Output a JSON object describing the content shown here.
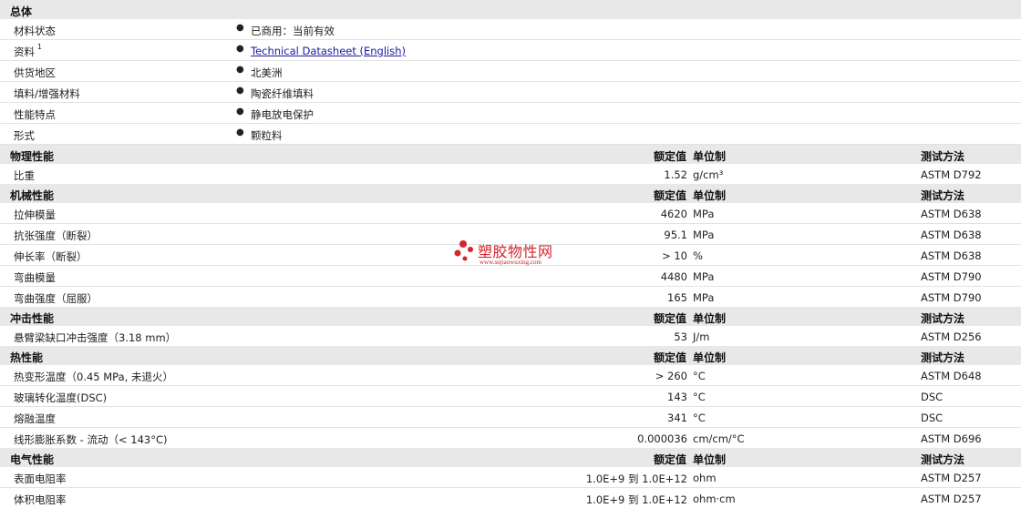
{
  "general": {
    "title": "总体",
    "rows": [
      {
        "label": "材料状态",
        "value": "已商用：当前有效"
      },
      {
        "label": "资料",
        "sup": "1",
        "value": "Technical Datasheet (English)",
        "link": true
      },
      {
        "label": "供货地区",
        "value": "北美洲"
      },
      {
        "label": "填料/增强材料",
        "value": "陶瓷纤维填料"
      },
      {
        "label": "性能特点",
        "value": "静电放电保护"
      },
      {
        "label": "形式",
        "value": "颗粒料"
      }
    ]
  },
  "headers": {
    "nominal": "额定值",
    "unit": "单位制",
    "test": "测试方法"
  },
  "sections": [
    {
      "key": "physical",
      "title": "物理性能",
      "rows": [
        {
          "label": "比重",
          "nominal": "1.52",
          "unit": "g/cm³",
          "test": "ASTM D792"
        }
      ]
    },
    {
      "key": "mechanical",
      "title": "机械性能",
      "rows": [
        {
          "label": "拉伸模量",
          "nominal": "4620",
          "unit": "MPa",
          "test": "ASTM D638"
        },
        {
          "label": "抗张强度（断裂）",
          "nominal": "95.1",
          "unit": "MPa",
          "test": "ASTM D638"
        },
        {
          "label": "伸长率（断裂）",
          "nominal": "> 10",
          "unit": "%",
          "test": "ASTM D638"
        },
        {
          "label": "弯曲模量",
          "nominal": "4480",
          "unit": "MPa",
          "test": "ASTM D790"
        },
        {
          "label": "弯曲强度（屈服）",
          "nominal": "165",
          "unit": "MPa",
          "test": "ASTM D790"
        }
      ]
    },
    {
      "key": "impact",
      "title": "冲击性能",
      "rows": [
        {
          "label": "悬臂梁缺口冲击强度（3.18 mm）",
          "nominal": "53",
          "unit": "J/m",
          "test": "ASTM D256"
        }
      ]
    },
    {
      "key": "thermal",
      "title": "热性能",
      "rows": [
        {
          "label": "热变形温度（0.45 MPa, 未退火）",
          "nominal": "> 260",
          "unit": "°C",
          "test": "ASTM D648"
        },
        {
          "label": "玻璃转化温度(DSC)",
          "nominal": "143",
          "unit": "°C",
          "test": "DSC"
        },
        {
          "label": "熔融温度",
          "nominal": "341",
          "unit": "°C",
          "test": "DSC"
        },
        {
          "label": "线形膨胀系数 - 流动（< 143°C)",
          "nominal": "0.000036",
          "unit": "cm/cm/°C",
          "test": "ASTM D696"
        }
      ]
    },
    {
      "key": "electrical",
      "title": "电气性能",
      "rows": [
        {
          "label": "表面电阻率",
          "nominal": "1.0E+9 到  1.0E+12",
          "unit": "ohm",
          "test": "ASTM D257"
        },
        {
          "label": "体积电阻率",
          "nominal": "1.0E+9 到  1.0E+12",
          "unit": "ohm·cm",
          "test": "ASTM D257"
        }
      ]
    }
  ],
  "watermark": {
    "name": "塑胶物性网",
    "url": "www.sujiaowuxing.com",
    "color": "#d4252a"
  }
}
